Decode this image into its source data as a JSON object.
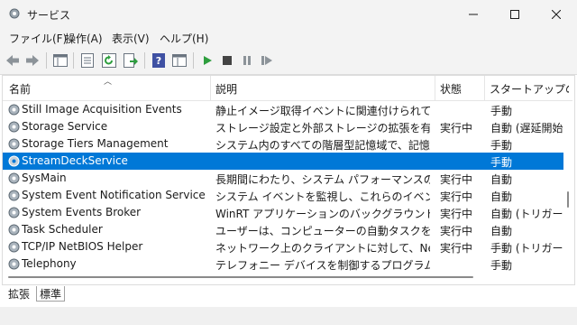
{
  "window": {
    "title": "サービス",
    "icon": "services-gear-icon"
  },
  "menu": [
    "ファイル(F)",
    "操作(A)",
    "表示(V)",
    "ヘルプ(H)"
  ],
  "toolbar": [
    "back-icon",
    "forward-icon",
    "show-hide-tree-icon",
    "properties-icon",
    "refresh-icon",
    "export-list-icon",
    "help-icon",
    "console-view-icon",
    "start-service-icon",
    "stop-service-icon",
    "pause-service-icon",
    "restart-service-icon"
  ],
  "columns": {
    "name": "名前",
    "desc": "説明",
    "status": "状態",
    "startup": "スタートアップの種"
  },
  "services": [
    {
      "name": "Still Image Acquisition Events",
      "desc": "静止イメージ取得イベントに関連付けられている...",
      "status": "",
      "startup": "手動"
    },
    {
      "name": "Storage Service",
      "desc": "ストレージ設定と外部ストレージの拡張を有効に...",
      "status": "実行中",
      "startup": "自動 (遅延開始"
    },
    {
      "name": "Storage Tiers Management",
      "desc": "システム内のすべての階層型記憶域で、記憶域...",
      "status": "",
      "startup": "手動"
    },
    {
      "name": "StreamDeckService",
      "desc": "",
      "status": "",
      "startup": "手動",
      "selected": true
    },
    {
      "name": "SysMain",
      "desc": "長期間にわたり、システム パフォーマンスの維持お...",
      "status": "実行中",
      "startup": "自動"
    },
    {
      "name": "System Event Notification Service",
      "desc": "システム イベントを監視し、これらのイベントの CO...",
      "status": "実行中",
      "startup": "自動"
    },
    {
      "name": "System Events Broker",
      "desc": "WinRT アプリケーションのバックグラウンド処理の...",
      "status": "実行中",
      "startup": "自動 (トリガー開"
    },
    {
      "name": "Task Scheduler",
      "desc": "ユーザーは、コンピューターの自動タスクを構成およ...",
      "status": "実行中",
      "startup": "自動"
    },
    {
      "name": "TCP/IP NetBIOS Helper",
      "desc": "ネットワーク上のクライアントに対して、NetBIOS o...",
      "status": "実行中",
      "startup": "手動 (トリガー開"
    },
    {
      "name": "Telephony",
      "desc": "テレフォニー デバイスを制御するプログラムを使用し...",
      "status": "",
      "startup": "手動"
    }
  ],
  "tabs": [
    "拡張",
    "標準"
  ],
  "colors": {
    "selection": "#0078d7",
    "chrome": "#f3f3f3"
  }
}
